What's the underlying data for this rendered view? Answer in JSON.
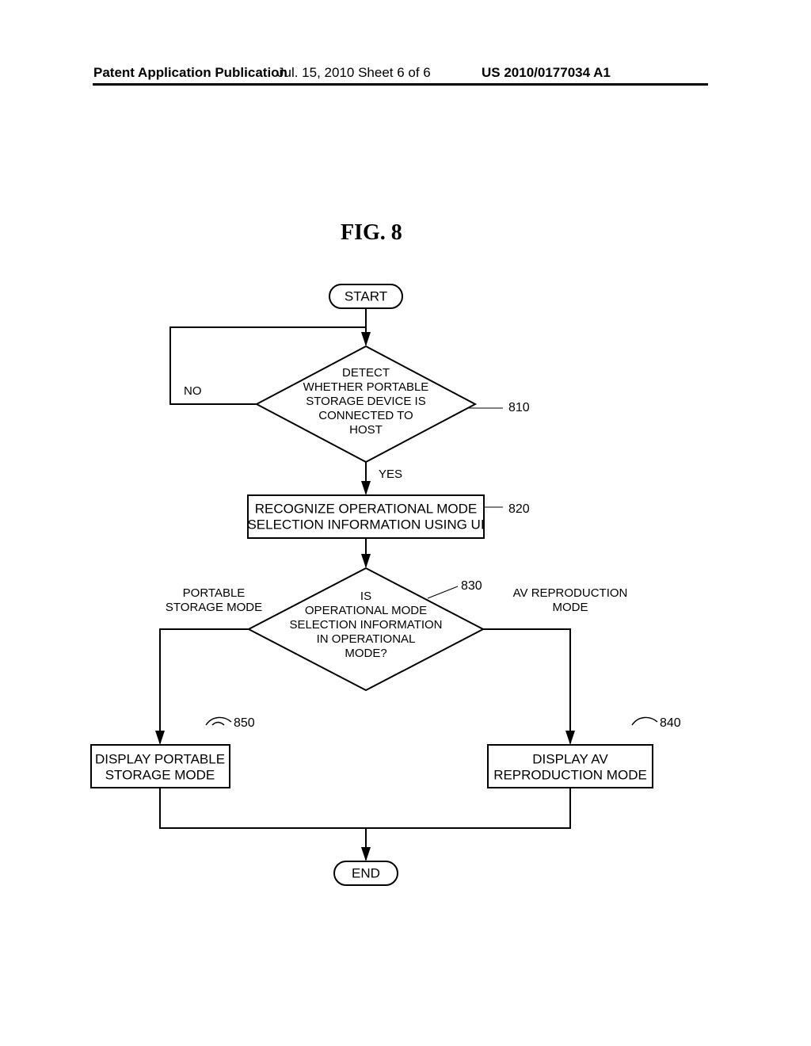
{
  "header": {
    "left": "Patent Application Publication",
    "center": "Jul. 15, 2010  Sheet 6 of 6",
    "right": "US 2010/0177034 A1"
  },
  "figure_title": "FIG.  8",
  "terminals": {
    "start": "START",
    "end": "END"
  },
  "decisions": {
    "d810": {
      "l1": "DETECT",
      "l2": "WHETHER PORTABLE",
      "l3": "STORAGE DEVICE IS",
      "l4": "CONNECTED TO",
      "l5": "HOST",
      "yes": "YES",
      "no": "NO",
      "ref": "810"
    },
    "d830": {
      "l1": "IS",
      "l2": "OPERATIONAL MODE",
      "l3": "SELECTION INFORMATION",
      "l4": "IN OPERATIONAL",
      "l5": "MODE?",
      "left1": "PORTABLE",
      "left2": "STORAGE MODE",
      "right1": "AV REPRODUCTION",
      "right2": "MODE",
      "ref": "830"
    }
  },
  "processes": {
    "p820": {
      "l1": "RECOGNIZE OPERATIONAL MODE",
      "l2": "SELECTION INFORMATION USING UI",
      "ref": "820"
    },
    "p840": {
      "l1": "DISPLAY AV",
      "l2": "REPRODUCTION MODE",
      "ref": "840"
    },
    "p850": {
      "l1": "DISPLAY PORTABLE",
      "l2": "STORAGE MODE",
      "ref": "850"
    }
  }
}
